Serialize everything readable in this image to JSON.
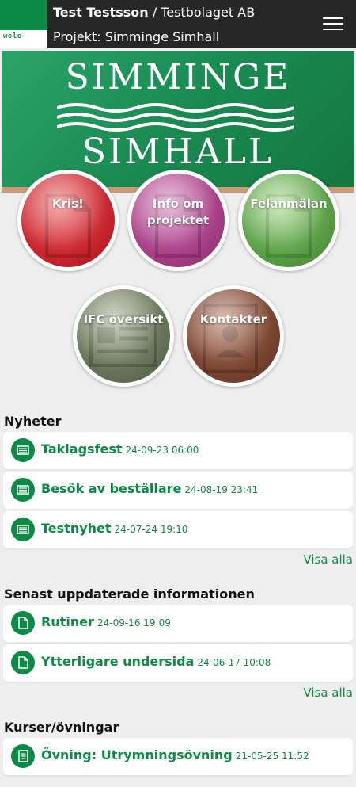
{
  "header": {
    "logo_text": "wolo",
    "user_name": "Test Testsson",
    "separator": " / ",
    "company": "Testbolaget AB",
    "project": "Projekt: Simminge Simhall"
  },
  "banner": {
    "line1": "SIMMINGE",
    "line2": "SIMHALL"
  },
  "tiles": [
    {
      "label": "Kris!",
      "color": "#c8262e"
    },
    {
      "label": "Info om projektet",
      "color": "#a73f86"
    },
    {
      "label": "Felanmälan",
      "color": "#5a9f46"
    },
    {
      "label": "IFC översikt",
      "color": "#67745a"
    },
    {
      "label": "Kontakter",
      "color": "#7a4430"
    }
  ],
  "news": {
    "heading": "Nyheter",
    "items": [
      {
        "title": "Taklagsfest",
        "date": "24-09-23 06:00",
        "icon": "newspaper-icon"
      },
      {
        "title": "Besök av beställare",
        "date": "24-08-19 23:41",
        "icon": "newspaper-icon"
      },
      {
        "title": "Testnyhet",
        "date": "24-07-24 19:10",
        "icon": "newspaper-icon"
      }
    ],
    "show_all": "Visa alla"
  },
  "updated": {
    "heading": "Senast uppdaterade informationen",
    "items": [
      {
        "title": "Rutiner",
        "date": "24-09-16 19:09",
        "icon": "document-icon"
      },
      {
        "title": "Ytterligare undersida",
        "date": "24-06-17 10:08",
        "icon": "document-icon"
      }
    ],
    "show_all": "Visa alla"
  },
  "courses": {
    "heading": "Kurser/övningar",
    "items": [
      {
        "title": "Övning: Utrymningsövning",
        "date": "21-05-25 11:52",
        "icon": "checklist-icon"
      }
    ]
  },
  "colors": {
    "brand_green": "#0d8a46",
    "topbar": "#272727",
    "background": "#eeeeee"
  }
}
